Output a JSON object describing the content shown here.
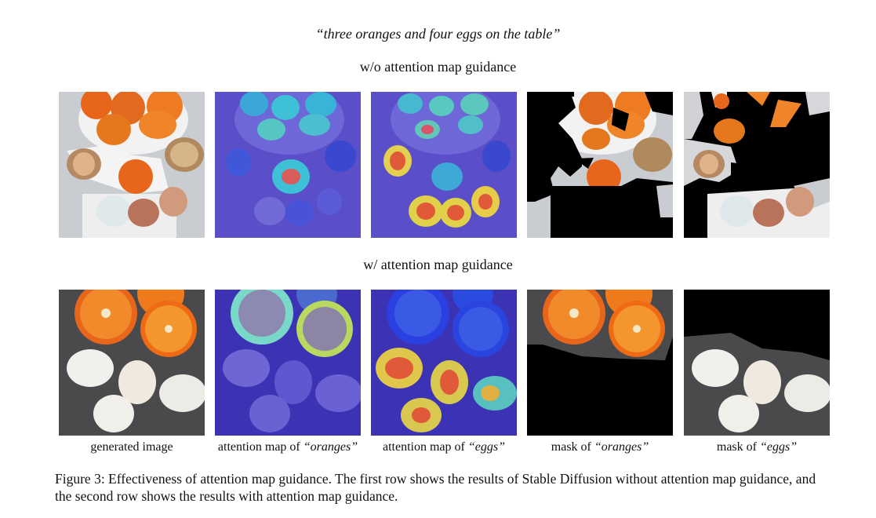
{
  "figure": {
    "prompt": "“three oranges and four eggs on the table”",
    "row1_label": "w/o attention map guidance",
    "row2_label": "w/ attention map guidance",
    "columns": [
      {
        "prefix": "generated image",
        "quoted": ""
      },
      {
        "prefix": "attention map of ",
        "quoted": "“oranges”"
      },
      {
        "prefix": "attention map of ",
        "quoted": "“eggs”"
      },
      {
        "prefix": "mask of ",
        "quoted": "“oranges”"
      },
      {
        "prefix": "mask of ",
        "quoted": "“eggs”"
      }
    ],
    "caption": "Figure 3: Effectiveness of attention map guidance. The first row shows the results of Stable Diffusion without attention map guidance, and the second row shows the results with attention map guidance."
  },
  "colors": {
    "orange": "#e8661c",
    "egg_brown": "#c98d5e",
    "egg_white": "#eceae4",
    "attention_bg": "#5a4fc8",
    "mask_black": "#000000",
    "table_gray": "#4a4a4c"
  }
}
